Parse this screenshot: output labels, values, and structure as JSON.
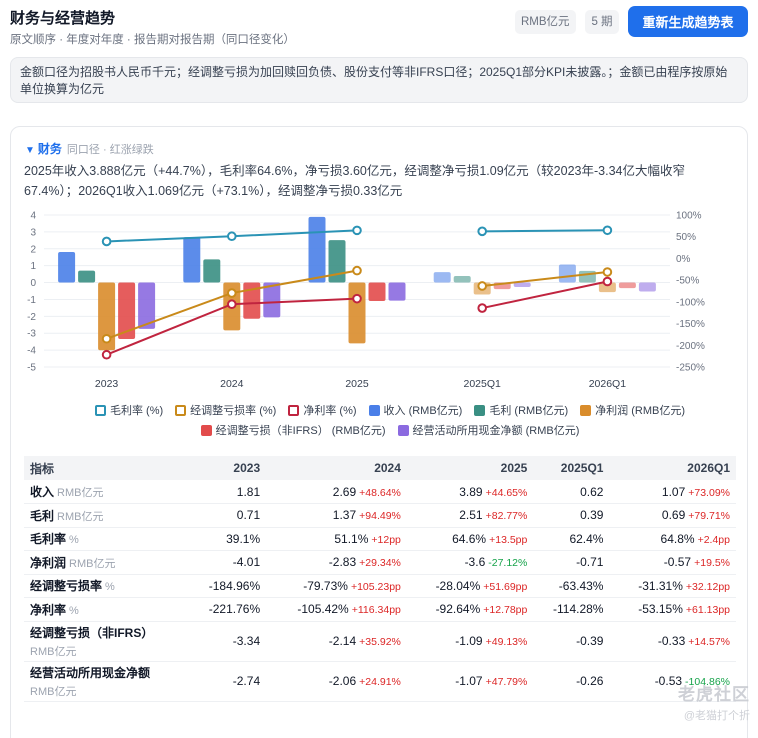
{
  "header": {
    "title": "财务与经营趋势",
    "subtitle": "原文顺序 · 年度对年度 · 报告期对报告期（同口径变化）",
    "unit_chip": "RMB亿元",
    "period_chip": "5 期",
    "regen_button": "重新生成趋势表"
  },
  "notice": "金额口径为招股书人民币千元；经调整亏损为加回赎回负债、股份支付等非IFRS口径；2025Q1部分KPI未披露。；金额已由程序按原始单位换算为亿元",
  "card": {
    "caret": "▼",
    "label": "财务",
    "hint": "同口径 · 红涨绿跌",
    "summary_line1": "2025年收入3.888亿元（+44.7%），毛利率64.6%，净亏损3.60亿元，经调整净亏损1.09亿元（较2023年-3.34亿大幅收窄",
    "summary_line2": "67.4%）；2026Q1收入1.069亿元（+73.1%），经调整净亏损0.33亿元"
  },
  "chart_data": {
    "type": "bar",
    "categories": [
      "2023",
      "2024",
      "2025",
      "2025Q1",
      "2026Q1"
    ],
    "left_axis": {
      "ylim": [
        -5,
        4
      ],
      "ticks": [
        4,
        3,
        2,
        1,
        0,
        -1,
        -2,
        -3,
        -4,
        -5
      ]
    },
    "right_axis": {
      "ylim": [
        -250,
        100
      ],
      "ticks": [
        "100%",
        "50%",
        "0%",
        "-50%",
        "-100%",
        "-150%",
        "-200%",
        "-250%"
      ]
    },
    "bar_series": [
      {
        "name": "收入 (RMB亿元)",
        "color": "#4a7fe8",
        "values": [
          1.81,
          2.69,
          3.89,
          0.62,
          1.07
        ]
      },
      {
        "name": "毛利 (RMB亿元)",
        "color": "#3a8f83",
        "values": [
          0.71,
          1.37,
          2.51,
          0.39,
          0.69
        ]
      },
      {
        "name": "净利润 (RMB亿元)",
        "color": "#d98c2b",
        "values": [
          -4.01,
          -2.83,
          -3.6,
          -0.71,
          -0.57
        ]
      },
      {
        "name": "经调整亏损（非IFRS） (RMB亿元)",
        "color": "#e24b4b",
        "values": [
          -3.34,
          -2.14,
          -1.09,
          -0.39,
          -0.33
        ]
      },
      {
        "name": "经营活动所用现金净额 (RMB亿元)",
        "color": "#8b6ae0",
        "values": [
          -2.74,
          -2.06,
          -1.07,
          -0.26,
          -0.53
        ]
      }
    ],
    "line_series": [
      {
        "name": "毛利率 (%)",
        "color": "#2a93b5",
        "values": [
          39.1,
          51.1,
          64.6,
          62.4,
          64.8
        ]
      },
      {
        "name": "经调整亏损率 (%)",
        "color": "#c98a1a",
        "values": [
          -184.96,
          -79.73,
          -28.04,
          -63.43,
          -31.31
        ]
      },
      {
        "name": "净利率 (%)",
        "color": "#c0243f",
        "values": [
          -221.76,
          -105.42,
          -92.64,
          -114.28,
          -53.15
        ]
      }
    ],
    "legend_rows": [
      [
        {
          "name": "毛利率 (%)",
          "color": "#2a93b5",
          "hollow": true
        },
        {
          "name": "经调整亏损率 (%)",
          "color": "#c98a1a",
          "hollow": true
        },
        {
          "name": "净利率 (%)",
          "color": "#c0243f",
          "hollow": true
        },
        {
          "name": "收入 (RMB亿元)",
          "color": "#4a7fe8",
          "hollow": false
        },
        {
          "name": "毛利 (RMB亿元)",
          "color": "#3a8f83",
          "hollow": false
        },
        {
          "name": "净利润 (RMB亿元)",
          "color": "#d98c2b",
          "hollow": false
        }
      ],
      [
        {
          "name": "经调整亏损（非IFRS） (RMB亿元)",
          "color": "#e24b4b",
          "hollow": false
        },
        {
          "name": "经营活动所用现金净额 (RMB亿元)",
          "color": "#8b6ae0",
          "hollow": false
        }
      ]
    ]
  },
  "table": {
    "headers": [
      "指标",
      "2023",
      "2024",
      "2025",
      "2025Q1",
      "2026Q1"
    ],
    "rows": [
      {
        "label": "收入",
        "unit": "RMB亿元",
        "cells": [
          [
            "1.81",
            ""
          ],
          [
            "2.69",
            "+48.64%"
          ],
          [
            "3.89",
            "+44.65%"
          ],
          [
            "0.62",
            ""
          ],
          [
            "1.07",
            "+73.09%"
          ]
        ]
      },
      {
        "label": "毛利",
        "unit": "RMB亿元",
        "cells": [
          [
            "0.71",
            ""
          ],
          [
            "1.37",
            "+94.49%"
          ],
          [
            "2.51",
            "+82.77%"
          ],
          [
            "0.39",
            ""
          ],
          [
            "0.69",
            "+79.71%"
          ]
        ]
      },
      {
        "label": "毛利率",
        "unit": "%",
        "cells": [
          [
            "39.1%",
            ""
          ],
          [
            "51.1%",
            "+12pp"
          ],
          [
            "64.6%",
            "+13.5pp"
          ],
          [
            "62.4%",
            ""
          ],
          [
            "64.8%",
            "+2.4pp"
          ]
        ]
      },
      {
        "label": "净利润",
        "unit": "RMB亿元",
        "cells": [
          [
            "-4.01",
            ""
          ],
          [
            "-2.83",
            "+29.34%"
          ],
          [
            "-3.6",
            "-27.12%"
          ],
          [
            "-0.71",
            ""
          ],
          [
            "-0.57",
            "+19.5%"
          ]
        ]
      },
      {
        "label": "经调整亏损率",
        "unit": "%",
        "cells": [
          [
            "-184.96%",
            ""
          ],
          [
            "-79.73%",
            "+105.23pp"
          ],
          [
            "-28.04%",
            "+51.69pp"
          ],
          [
            "-63.43%",
            ""
          ],
          [
            "-31.31%",
            "+32.12pp"
          ]
        ]
      },
      {
        "label": "净利率",
        "unit": "%",
        "cells": [
          [
            "-221.76%",
            ""
          ],
          [
            "-105.42%",
            "+116.34pp"
          ],
          [
            "-92.64%",
            "+12.78pp"
          ],
          [
            "-114.28%",
            ""
          ],
          [
            "-53.15%",
            "+61.13pp"
          ]
        ]
      },
      {
        "label": "经调整亏损（非IFRS）",
        "unit": "RMB亿元",
        "cells": [
          [
            "-3.34",
            ""
          ],
          [
            "-2.14",
            "+35.92%"
          ],
          [
            "-1.09",
            "+49.13%"
          ],
          [
            "-0.39",
            ""
          ],
          [
            "-0.33",
            "+14.57%"
          ]
        ]
      },
      {
        "label": "经营活动所用现金净额",
        "unit": "RMB亿元",
        "cells": [
          [
            "-2.74",
            ""
          ],
          [
            "-2.06",
            "+24.91%"
          ],
          [
            "-1.07",
            "+47.79%"
          ],
          [
            "-0.26",
            ""
          ],
          [
            "-0.53",
            "-104.86%"
          ]
        ]
      }
    ]
  },
  "watermark": {
    "big": "老虎社区",
    "small": "@老猫打个折"
  }
}
